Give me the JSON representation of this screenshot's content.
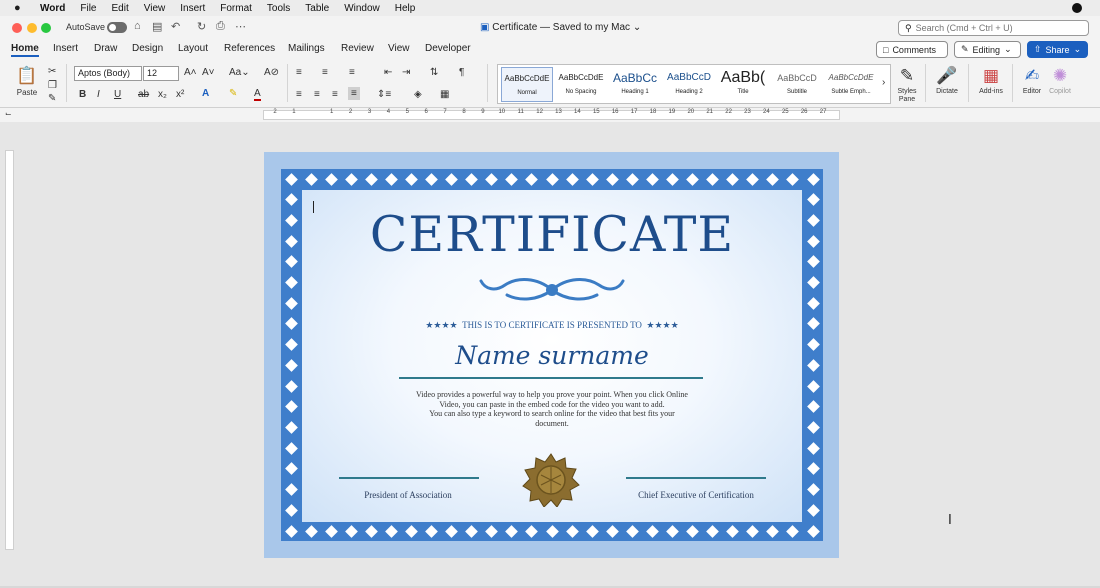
{
  "menubar": {
    "apple_icon": "",
    "items": [
      "Word",
      "File",
      "Edit",
      "View",
      "Insert",
      "Format",
      "Tools",
      "Table",
      "Window",
      "Help"
    ]
  },
  "titlebar": {
    "autosave_label": "AutoSave",
    "autosave_on": false,
    "document_title": "Certificate — Saved to my Mac",
    "search_placeholder": "Search (Cmd + Ctrl + U)"
  },
  "tabs": {
    "items": [
      "Home",
      "Insert",
      "Draw",
      "Design",
      "Layout",
      "References",
      "Mailings",
      "Review",
      "View",
      "Developer"
    ],
    "active": "Home"
  },
  "actions": {
    "comments": "Comments",
    "editing": "Editing",
    "share": "Share"
  },
  "ribbon": {
    "paste": "Paste",
    "font_name": "Aptos (Body)",
    "font_size": "12",
    "styles": [
      {
        "sample": "AaBbCcDdE",
        "name": "Normal"
      },
      {
        "sample": "AaBbCcDdE",
        "name": "No Spacing"
      },
      {
        "sample": "AaBbCc",
        "name": "Heading 1"
      },
      {
        "sample": "AaBbCcD",
        "name": "Heading 2"
      },
      {
        "sample": "AaBb(",
        "name": "Title"
      },
      {
        "sample": "AaBbCcD",
        "name": "Subtitle"
      },
      {
        "sample": "AaBbCcDdE",
        "name": "Subtle Emph..."
      }
    ],
    "styles_pane": "Styles Pane",
    "dictate": "Dictate",
    "addins": "Add-ins",
    "editor": "Editor",
    "copilot": "Copilot"
  },
  "ruler": {
    "numbers": [
      "2",
      "1",
      "",
      "1",
      "2",
      "3",
      "4",
      "5",
      "6",
      "7",
      "8",
      "9",
      "10",
      "11",
      "12",
      "13",
      "14",
      "15",
      "16",
      "17",
      "18",
      "19",
      "20",
      "21",
      "22",
      "23",
      "24",
      "25",
      "26",
      "27"
    ]
  },
  "certificate": {
    "title": "CERTIFICATE",
    "presented_to": "THIS IS TO CERTIFICATE IS PRESENTED TO",
    "stars": "★★★★",
    "name": "Name surname",
    "body_lines": [
      "Video provides a powerful way to help you prove your point. When you click Online",
      "Video, you can paste in the embed code for the video you want to add.",
      "You can also type a keyword to search online for the video that best fits your",
      "document."
    ],
    "signature_left": "President of Association",
    "signature_right": "Chief Executive of Certification"
  },
  "colors": {
    "frame_blue": "#3f7ecb",
    "title_blue": "#1e4d8b",
    "line_teal": "#2f7a8c",
    "share_blue": "#1b5fbf",
    "seal_gold": "#8b6d2f"
  }
}
